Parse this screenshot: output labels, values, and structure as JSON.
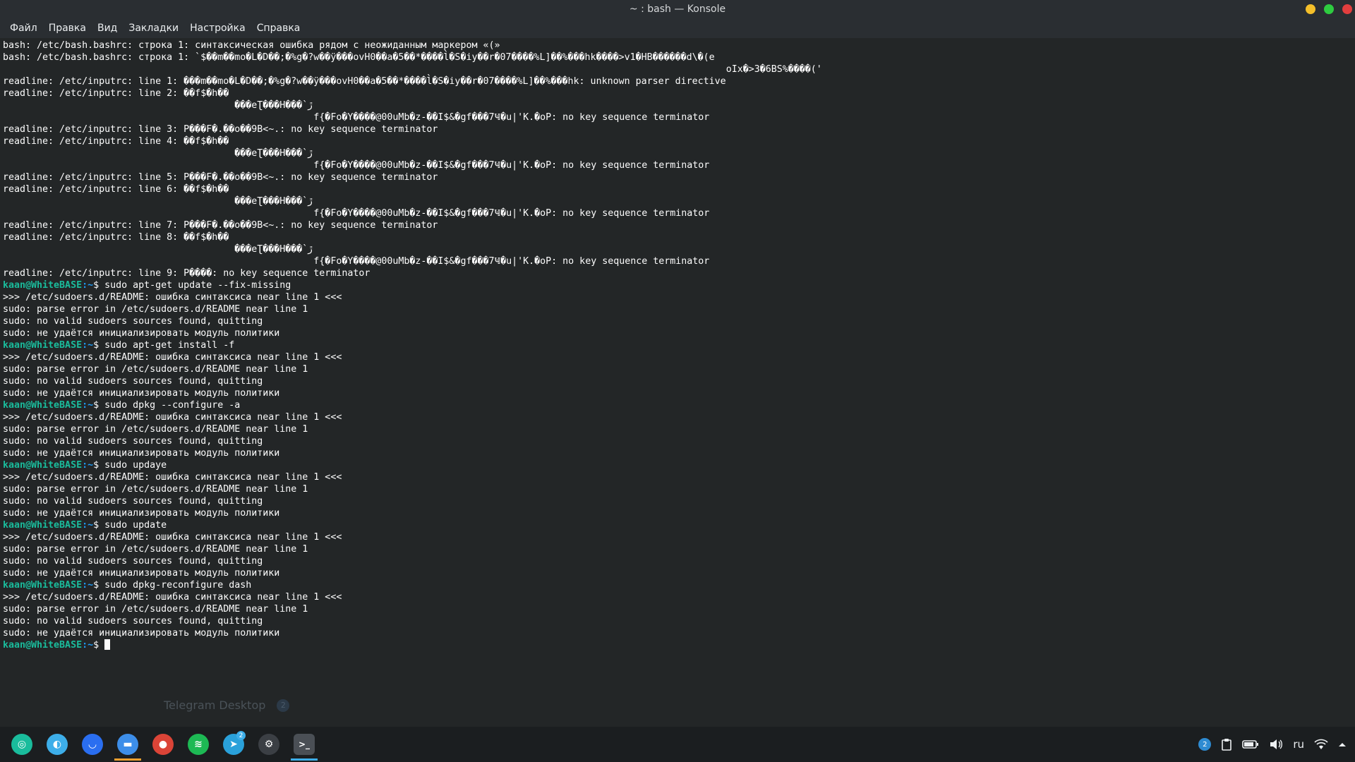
{
  "window": {
    "title": "~ : bash — Konsole"
  },
  "menu": [
    "Файл",
    "Правка",
    "Вид",
    "Закладки",
    "Настройка",
    "Справка"
  ],
  "terminal": {
    "lines": [
      {
        "text": "bash: /etc/bash.bashrc: строка 1: синтаксическая ошибка рядом с неожиданным маркером «(»"
      },
      {
        "text": "bash: /etc/bash.bashrc: строка 1: `$��m��mo�L�D��;�%g�?w��ÿ���ovH0��a�5��*����l̀�S�iy��r�07����%L]��%���hk����>v1�HB������d\\�(e"
      },
      {
        "text": "                                                                                                                                oIx�>3�6BS%����('"
      },
      {
        "text": "readline: /etc/inputrc: line 1: ���m��mo�L�D��;�%g�?w��ÿ���ovH0��a�5��*����l̀�S�iy��r�07����%L]��%���hk: unknown parser directive"
      },
      {
        "text": "readline: /etc/inputrc: line 2: ��f$�h��"
      },
      {
        "text": "                                         ���eƮ���H���`ڙ"
      },
      {
        "text": "                                                       f{�Fo�Y����@00uMb�z-��I$&�gf���7Ҹ�u|'K.�oP: no key sequence terminator"
      },
      {
        "text": "readline: /etc/inputrc: line 3: P���F�.��o��9B<~.: no key sequence terminator"
      },
      {
        "text": "readline: /etc/inputrc: line 4: ��f$�h��"
      },
      {
        "text": "                                         ���eƮ���H���`ڙ"
      },
      {
        "text": "                                                       f{�Fo�Y����@00uMb�z-��I$&�gf���7Ҹ�u|'K.�oP: no key sequence terminator"
      },
      {
        "text": "readline: /etc/inputrc: line 5: P���F�.��o��9B<~.: no key sequence terminator"
      },
      {
        "text": "readline: /etc/inputrc: line 6: ��f$�h��"
      },
      {
        "text": "                                         ���eƮ���H���`ڙ"
      },
      {
        "text": "                                                       f{�Fo�Y����@00uMb�z-��I$&�gf���7Ҹ�u|'K.�oP: no key sequence terminator"
      },
      {
        "text": "readline: /etc/inputrc: line 7: P���F�.��o��9B<~.: no key sequence terminator"
      },
      {
        "text": "readline: /etc/inputrc: line 8: ��f$�h��"
      },
      {
        "text": "                                         ���eƮ���H���`ڙ"
      },
      {
        "text": "                                                       f{�Fo�Y����@00uMb�z-��I$&�gf���7Ҹ�u|'K.�oP: no key sequence terminator"
      },
      {
        "text": "readline: /etc/inputrc: line 9: P����: no key sequence terminator"
      },
      {
        "prompt": "kaan@WhiteBASE",
        "path": ":~",
        "cmd": "$ sudo apt-get update --fix-missing"
      },
      {
        "text": ">>> /etc/sudoers.d/README: ошибка синтаксиса near line 1 <<<"
      },
      {
        "text": "sudo: parse error in /etc/sudoers.d/README near line 1"
      },
      {
        "text": "sudo: no valid sudoers sources found, quitting"
      },
      {
        "text": "sudo: не удаётся инициализировать модуль политики"
      },
      {
        "prompt": "kaan@WhiteBASE",
        "path": ":~",
        "cmd": "$ sudo apt-get install -f"
      },
      {
        "text": ">>> /etc/sudoers.d/README: ошибка синтаксиса near line 1 <<<"
      },
      {
        "text": "sudo: parse error in /etc/sudoers.d/README near line 1"
      },
      {
        "text": "sudo: no valid sudoers sources found, quitting"
      },
      {
        "text": "sudo: не удаётся инициализировать модуль политики"
      },
      {
        "prompt": "kaan@WhiteBASE",
        "path": ":~",
        "cmd": "$ sudo dpkg --configure -a"
      },
      {
        "text": ">>> /etc/sudoers.d/README: ошибка синтаксиса near line 1 <<<"
      },
      {
        "text": "sudo: parse error in /etc/sudoers.d/README near line 1"
      },
      {
        "text": "sudo: no valid sudoers sources found, quitting"
      },
      {
        "text": "sudo: не удаётся инициализировать модуль политики"
      },
      {
        "prompt": "kaan@WhiteBASE",
        "path": ":~",
        "cmd": "$ sudo updaye"
      },
      {
        "text": ">>> /etc/sudoers.d/README: ошибка синтаксиса near line 1 <<<"
      },
      {
        "text": "sudo: parse error in /etc/sudoers.d/README near line 1"
      },
      {
        "text": "sudo: no valid sudoers sources found, quitting"
      },
      {
        "text": "sudo: не удаётся инициализировать модуль политики"
      },
      {
        "prompt": "kaan@WhiteBASE",
        "path": ":~",
        "cmd": "$ sudo update"
      },
      {
        "text": ">>> /etc/sudoers.d/README: ошибка синтаксиса near line 1 <<<"
      },
      {
        "text": "sudo: parse error in /etc/sudoers.d/README near line 1"
      },
      {
        "text": "sudo: no valid sudoers sources found, quitting"
      },
      {
        "text": "sudo: не удаётся инициализировать модуль политики"
      },
      {
        "prompt": "kaan@WhiteBASE",
        "path": ":~",
        "cmd": "$ sudo dpkg-reconfigure dash"
      },
      {
        "text": ">>> /etc/sudoers.d/README: ошибка синтаксиса near line 1 <<<"
      },
      {
        "text": "sudo: parse error in /etc/sudoers.d/README near line 1"
      },
      {
        "text": "sudo: no valid sudoers sources found, quitting"
      },
      {
        "text": "sudo: не удаётся инициализировать модуль политики"
      },
      {
        "prompt": "kaan@WhiteBASE",
        "path": ":~",
        "cmd": "$ ",
        "cursor": true
      }
    ]
  },
  "notification": {
    "title": "Telegram Desktop",
    "count": "2"
  },
  "taskbar": {
    "apps": [
      {
        "name": "app-launcher-icon",
        "color": "#1abc9c"
      },
      {
        "name": "discover-icon",
        "color": "#3daee9"
      },
      {
        "name": "plasma-browser-icon",
        "color": "#2a6ef0"
      },
      {
        "name": "file-manager-icon",
        "color": "#3d8ee9",
        "running": true
      },
      {
        "name": "chrome-icon",
        "color": "#db4437"
      },
      {
        "name": "spotify-icon",
        "color": "#1db954"
      },
      {
        "name": "telegram-icon",
        "color": "#2aa1da",
        "badge": "2"
      },
      {
        "name": "steam-icon",
        "color": "#3b3f44"
      },
      {
        "name": "konsole-icon",
        "color": "#4a4f55",
        "active": true
      }
    ],
    "tray": {
      "vpn_badge": "2",
      "language": "ru"
    }
  },
  "colors": {
    "prompt": "#1abc9c",
    "path": "#1d99f3",
    "background": "#232627",
    "accent": "#3daee9"
  }
}
